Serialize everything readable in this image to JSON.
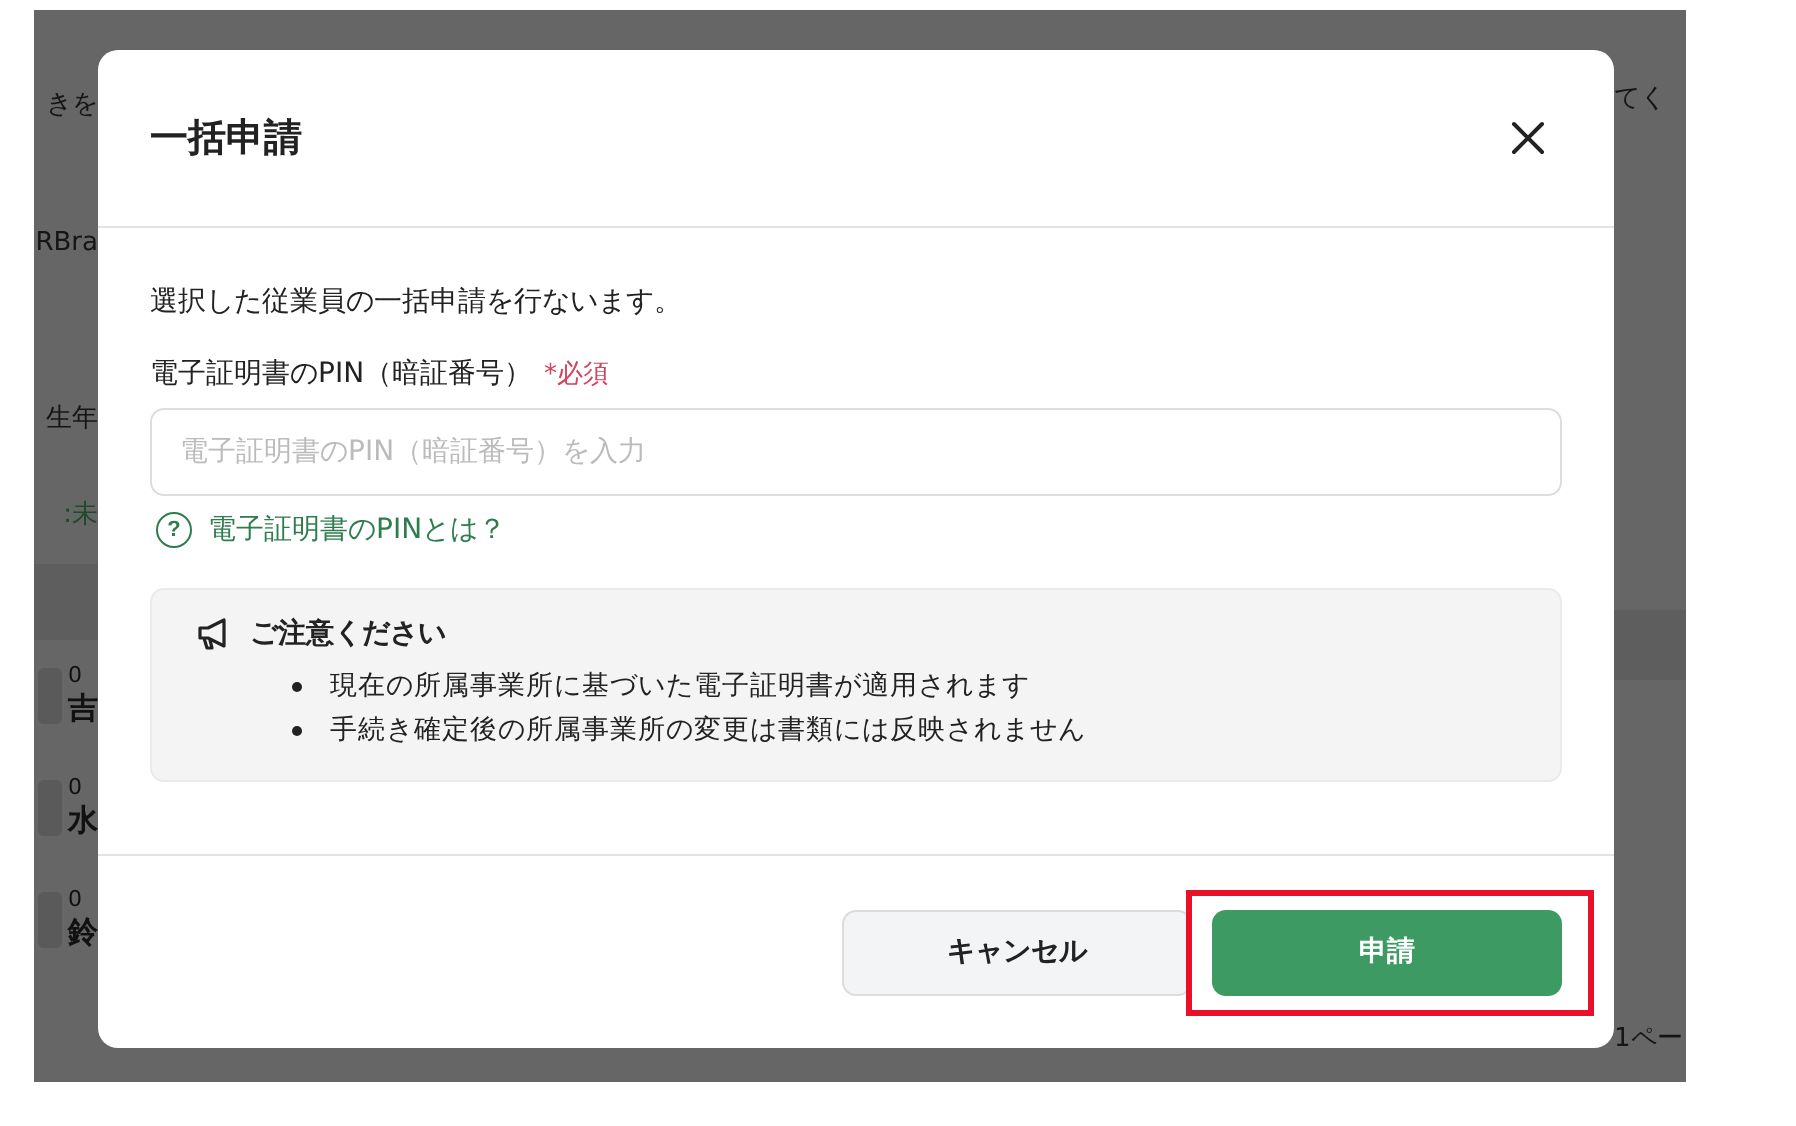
{
  "background_page": {
    "left_fragments": [
      {
        "kind": "text",
        "text": "きを"
      },
      {
        "kind": "text",
        "text": "RBra"
      },
      {
        "kind": "blank"
      },
      {
        "kind": "text",
        "text": "生年"
      },
      {
        "kind": "link",
        "text": ":未"
      },
      {
        "kind": "header"
      },
      {
        "kind": "person",
        "code": "0",
        "name": "吉"
      },
      {
        "kind": "person",
        "code": "0",
        "name": "水"
      },
      {
        "kind": "person",
        "code": "0",
        "name": "鈴"
      }
    ],
    "right_fragments": [
      {
        "kind": "text",
        "text": "てく"
      },
      {
        "kind": "blank"
      },
      {
        "kind": "blank"
      },
      {
        "kind": "blank"
      },
      {
        "kind": "blank"
      },
      {
        "kind": "header"
      },
      {
        "kind": "blank"
      },
      {
        "kind": "blank"
      },
      {
        "kind": "blank"
      }
    ],
    "pager": "1ペー"
  },
  "dialog": {
    "title": "一括申請",
    "description": "選択した従業員の一括申請を行ないます。",
    "field": {
      "label": "電子証明書のPIN（暗証番号）",
      "required_mark": "*必須",
      "placeholder": "電子証明書のPIN（暗証番号）を入力"
    },
    "help_icon": "?",
    "help_link": "電子証明書のPINとは？",
    "notice": {
      "title": "ご注意ください",
      "items": [
        "現在の所属事業所に基づいた電子証明書が適用されます",
        "手続き確定後の所属事業所の変更は書類には反映されません"
      ]
    },
    "buttons": [
      {
        "kind": "secondary",
        "label": "キャンセル",
        "highlighted": false
      },
      {
        "kind": "primary",
        "label": "申請",
        "highlighted": true
      }
    ]
  }
}
